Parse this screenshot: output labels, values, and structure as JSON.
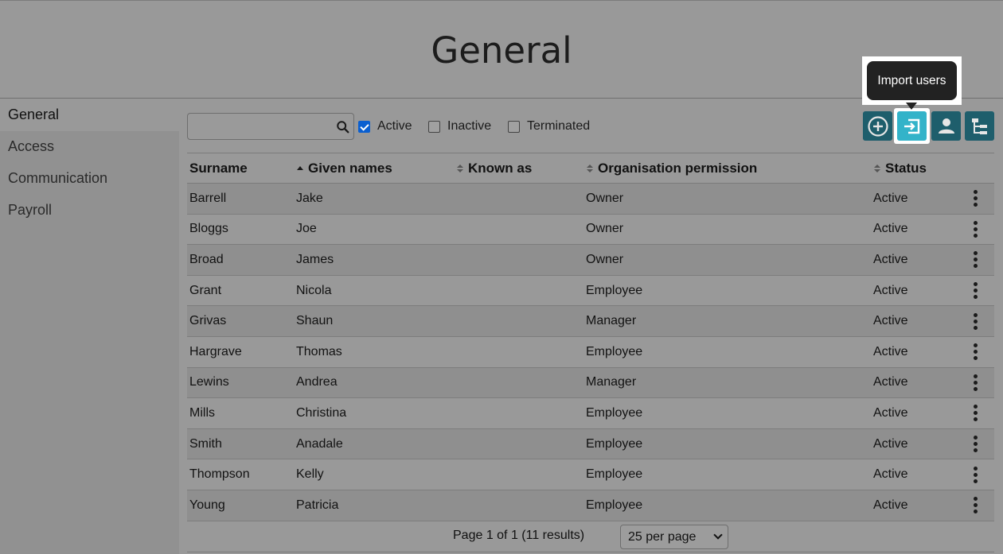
{
  "header": {
    "title": "General"
  },
  "sidebar": {
    "items": [
      {
        "label": "General"
      },
      {
        "label": "Access"
      },
      {
        "label": "Communication"
      },
      {
        "label": "Payroll"
      }
    ]
  },
  "toolbar": {
    "search": {
      "value": "",
      "placeholder": ""
    },
    "filters": [
      {
        "label": "Active",
        "checked": true
      },
      {
        "label": "Inactive",
        "checked": false
      },
      {
        "label": "Terminated",
        "checked": false
      }
    ],
    "buttons": [
      {
        "icon": "add-circle-icon"
      },
      {
        "icon": "import-icon"
      },
      {
        "icon": "person-icon"
      },
      {
        "icon": "org-chart-icon"
      }
    ],
    "tooltip": "Import users"
  },
  "table": {
    "columns": [
      "Surname",
      "Given names",
      "Known as",
      "Organisation permission",
      "Status"
    ],
    "rows": [
      {
        "surname": "Barrell",
        "given": "Jake",
        "known": "",
        "permission": "Owner",
        "status": "Active"
      },
      {
        "surname": "Bloggs",
        "given": "Joe",
        "known": "",
        "permission": "Owner",
        "status": "Active"
      },
      {
        "surname": "Broad",
        "given": "James",
        "known": "",
        "permission": "Owner",
        "status": "Active"
      },
      {
        "surname": "Grant",
        "given": "Nicola",
        "known": "",
        "permission": "Employee",
        "status": "Active"
      },
      {
        "surname": "Grivas",
        "given": "Shaun",
        "known": "",
        "permission": "Manager",
        "status": "Active"
      },
      {
        "surname": "Hargrave",
        "given": "Thomas",
        "known": "",
        "permission": "Employee",
        "status": "Active"
      },
      {
        "surname": "Lewins",
        "given": "Andrea",
        "known": "",
        "permission": "Manager",
        "status": "Active"
      },
      {
        "surname": "Mills",
        "given": "Christina",
        "known": "",
        "permission": "Employee",
        "status": "Active"
      },
      {
        "surname": "Smith",
        "given": "Anadale",
        "known": "",
        "permission": "Employee",
        "status": "Active"
      },
      {
        "surname": "Thompson",
        "given": "Kelly",
        "known": "",
        "permission": "Employee",
        "status": "Active"
      },
      {
        "surname": "Young",
        "given": "Patricia",
        "known": "",
        "permission": "Employee",
        "status": "Active"
      }
    ]
  },
  "pager": {
    "text": "Page 1 of 1 (11 results)",
    "per_page": "25 per page"
  },
  "colors": {
    "button": "#1e5e6c",
    "button_highlight": "#33b3c9",
    "link": "#17596a"
  }
}
